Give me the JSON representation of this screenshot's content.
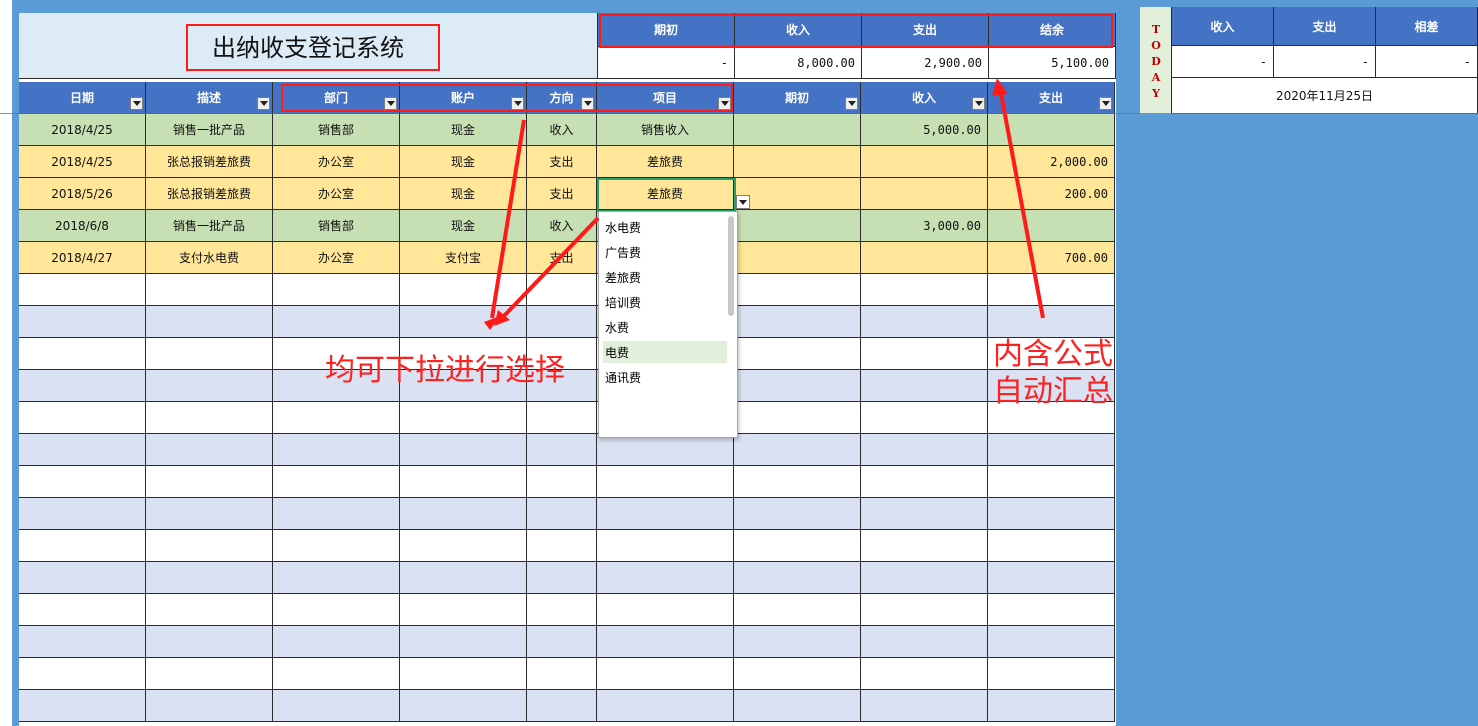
{
  "title": "出纳收支登记系统",
  "summary": {
    "headers": [
      "期初",
      "收入",
      "支出",
      "结余"
    ],
    "values": [
      "-",
      "8,000.00",
      "2,900.00",
      "5,100.00"
    ]
  },
  "table": {
    "headers": [
      "日期",
      "描述",
      "部门",
      "账户",
      "方向",
      "项目",
      "期初",
      "收入",
      "支出"
    ],
    "rows": [
      [
        "2018/4/25",
        "销售一批产品",
        "销售部",
        "现金",
        "收入",
        "销售收入",
        "",
        "5,000.00",
        ""
      ],
      [
        "2018/4/25",
        "张总报销差旅费",
        "办公室",
        "现金",
        "支出",
        "差旅费",
        "",
        "",
        "2,000.00"
      ],
      [
        "2018/5/26",
        "张总报销差旅费",
        "办公室",
        "现金",
        "支出",
        "差旅费",
        "",
        "",
        "200.00"
      ],
      [
        "2018/6/8",
        "销售一批产品",
        "销售部",
        "现金",
        "收入",
        "",
        "",
        "3,000.00",
        ""
      ],
      [
        "2018/4/27",
        "支付水电费",
        "办公室",
        "支付宝",
        "支出",
        "",
        "",
        "",
        "700.00"
      ]
    ]
  },
  "dropdown": {
    "options": [
      "水电费",
      "广告费",
      "差旅费",
      "培训费",
      "水费",
      "电费",
      "通讯费"
    ],
    "selected_index": 5
  },
  "today_panel": {
    "label_letters": [
      "T",
      "O",
      "D",
      "A",
      "Y"
    ],
    "headers": [
      "收入",
      "支出",
      "相差"
    ],
    "values": [
      "-",
      "-",
      "-"
    ],
    "date": "2020年11月25日"
  },
  "annotations": {
    "dropdown_note": "均可下拉进行选择",
    "formula_note_line1": "内含公式",
    "formula_note_line2": "自动汇总"
  },
  "colors": {
    "header_blue": "#4472c4",
    "row_green": "#c6e0b4",
    "row_yellow": "#ffe699",
    "row_blue": "#d9e1f2",
    "annotation_red": "#ff1a1a",
    "background": "#5b9bd5"
  }
}
